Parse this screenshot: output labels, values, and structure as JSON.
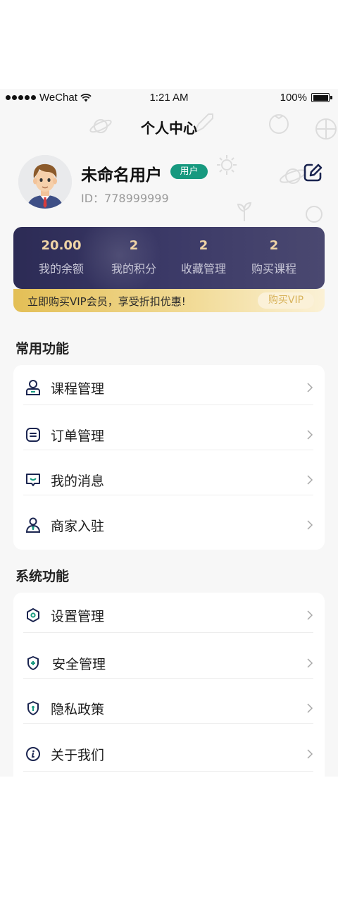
{
  "status_bar": {
    "carrier": "WeChat",
    "time": "1:21 AM",
    "battery": "100%"
  },
  "page_title": "个人中心",
  "profile": {
    "name": "未命名用户",
    "badge": "用户",
    "id_text": "ID：778999999"
  },
  "stats": [
    {
      "value": "20.00",
      "label": "我的余额"
    },
    {
      "value": "2",
      "label": "我的积分"
    },
    {
      "value": "2",
      "label": "收藏管理"
    },
    {
      "value": "2",
      "label": "购买课程"
    }
  ],
  "vip": {
    "text": "立即购买VIP会员，享受折扣优惠!",
    "button": "购买VIP"
  },
  "common_section": {
    "title": "常用功能",
    "items": [
      {
        "label": "课程管理",
        "icon": "course-user-icon"
      },
      {
        "label": "订单管理",
        "icon": "order-list-icon"
      },
      {
        "label": "我的消息",
        "icon": "message-icon"
      },
      {
        "label": "商家入驻",
        "icon": "merchant-icon"
      }
    ]
  },
  "system_section": {
    "title": "系统功能",
    "items": [
      {
        "label": "设置管理",
        "icon": "settings-hexagon-icon"
      },
      {
        "label": "安全管理",
        "icon": "shield-plus-icon"
      },
      {
        "label": "隐私政策",
        "icon": "privacy-shield-icon"
      },
      {
        "label": "关于我们",
        "icon": "info-icon"
      }
    ]
  },
  "colors": {
    "accent_badge": "#17997f",
    "card_dark": "#2c2b55",
    "gold": "#e3bf56",
    "stat_value": "#efd4a6"
  }
}
